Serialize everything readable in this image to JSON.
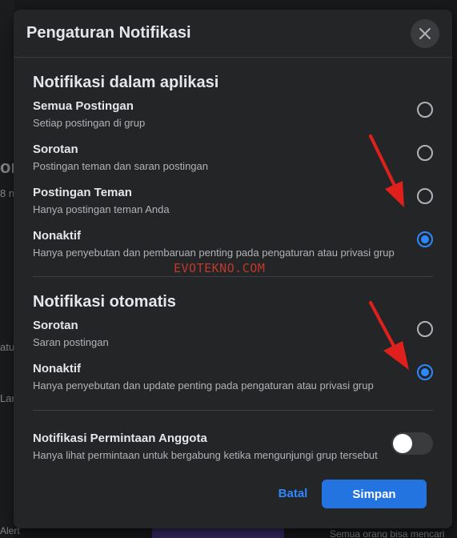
{
  "dialog": {
    "title": "Pengaturan Notifikasi"
  },
  "in_app": {
    "title": "Notifikasi dalam aplikasi",
    "options": [
      {
        "label": "Semua Postingan",
        "desc": "Setiap postingan di grup",
        "checked": false
      },
      {
        "label": "Sorotan",
        "desc": "Postingan teman dan saran postingan",
        "checked": false
      },
      {
        "label": "Postingan Teman",
        "desc": "Hanya postingan teman Anda",
        "checked": false
      },
      {
        "label": "Nonaktif",
        "desc": "Hanya penyebutan dan pembaruan penting pada pengaturan atau privasi grup",
        "checked": true
      }
    ]
  },
  "watermark": "EVOTEKNO.COM",
  "auto": {
    "title": "Notifikasi otomatis",
    "options": [
      {
        "label": "Sorotan",
        "desc": "Saran postingan",
        "checked": false
      },
      {
        "label": "Nonaktif",
        "desc": "Hanya penyebutan dan update penting pada pengaturan atau privasi grup",
        "checked": true
      }
    ]
  },
  "member_requests": {
    "label": "Notifikasi Permintaan Anggota",
    "desc": "Hanya lihat permintaan untuk bergabung ketika mengunjungi grup tersebut",
    "enabled": false
  },
  "buttons": {
    "cancel": "Batal",
    "save": "Simpan"
  },
  "background": {
    "fragments": [
      "on",
      "8 n",
      "Lar",
      "atu",
      "Alert",
      "Semua orang bisa mencari"
    ]
  },
  "colors": {
    "accent": "#2d88ff",
    "save_button": "#2374e1",
    "dialog_bg": "#242526",
    "annotation_arrow": "#e0201c"
  },
  "icons": [
    "close-icon",
    "arrow-annotation"
  ]
}
